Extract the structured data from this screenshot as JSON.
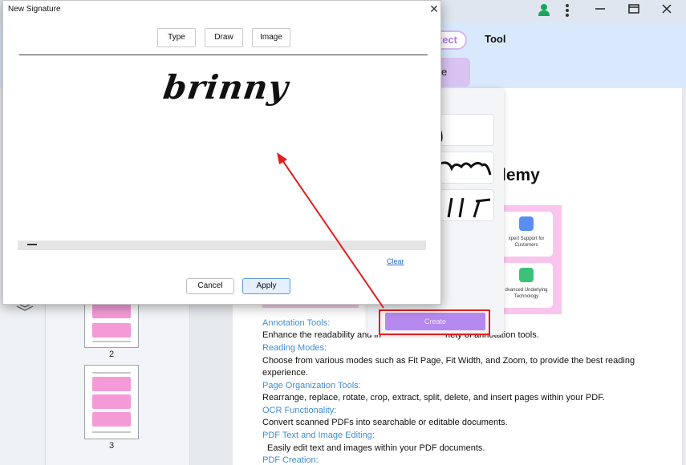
{
  "dialog": {
    "title": "New Signature",
    "modes": [
      "Type",
      "Draw",
      "Image"
    ],
    "signature_text": "brinny",
    "clear_label": "Clear",
    "cancel_label": "Cancel",
    "apply_label": "Apply"
  },
  "app": {
    "nav_active": "tect",
    "nav_tool": "Tool",
    "subtab": "e Sign",
    "create_label": "Create"
  },
  "document": {
    "heading_partial": "demy",
    "card1": "xpert Support for Customers",
    "card2": "dvanced Underlying Technology",
    "lines": [
      {
        "text": "Annotation Tools:",
        "style": "h"
      },
      {
        "text": "Enhance the readability and in",
        "style": "b"
      },
      {
        "text": "Reading Modes:",
        "style": "h"
      },
      {
        "text": "Choose from various modes such as Fit Page, Fit Width, and Zoom, to provide the best reading",
        "style": "b"
      },
      {
        "text": "experience.",
        "style": "b"
      },
      {
        "text": "Page Organization Tools:",
        "style": "h"
      },
      {
        "text": "Rearrange, replace, rotate, crop, extract, split, delete, and insert pages within your PDF.",
        "style": "b"
      },
      {
        "text": "OCR Functionality:",
        "style": "h"
      },
      {
        "text": "Convert scanned PDFs into searchable or editable documents.",
        "style": "b"
      },
      {
        "text": "PDF Text and Image Editing:",
        "style": "h"
      },
      {
        "text": "Easily edit text and images within your PDF documents.",
        "style": "b"
      },
      {
        "text": "PDF Creation:",
        "style": "h"
      }
    ],
    "annotation_tail": "riety of annotation tools."
  },
  "thumbnails": [
    "2",
    "3"
  ],
  "colors": {
    "accent": "#b589ee",
    "highlight": "#e41e1e",
    "link": "#3f8ed8"
  }
}
